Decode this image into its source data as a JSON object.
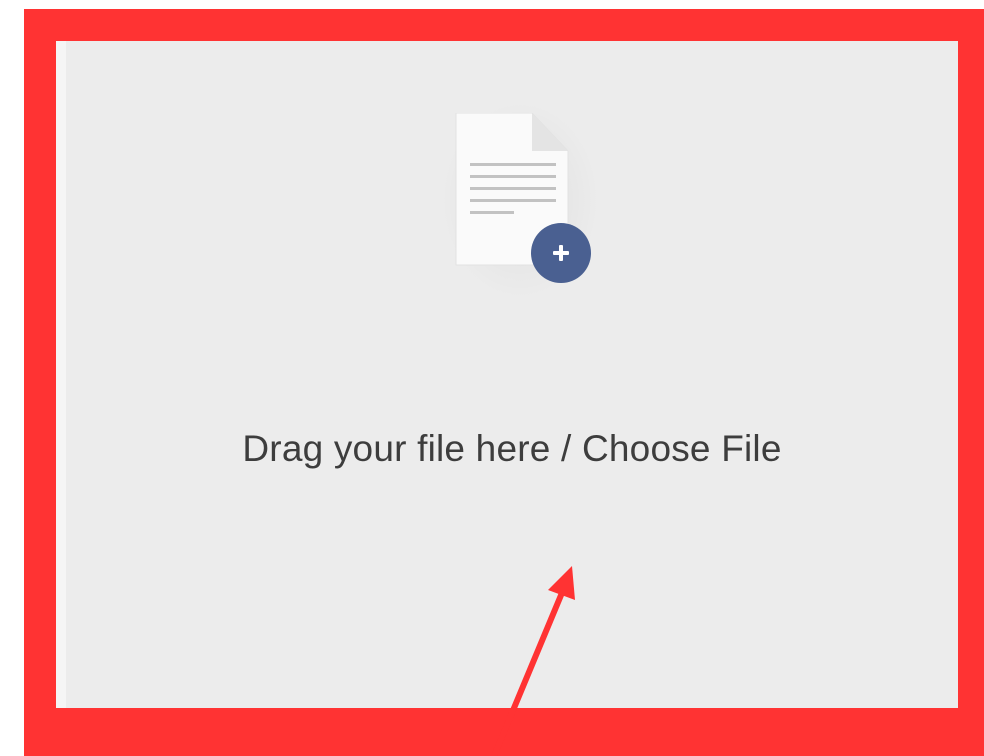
{
  "upload": {
    "prompt_text": "Drag your file here / Choose File",
    "icon": "document-add-icon",
    "plus_icon": "plus-icon"
  },
  "annotation": {
    "icon": "arrow-annotation-icon"
  },
  "colors": {
    "highlight_frame": "#ff3333",
    "drop_zone_bg": "#ececec",
    "plus_badge": "#4a6091",
    "text": "#3d3d3d"
  }
}
